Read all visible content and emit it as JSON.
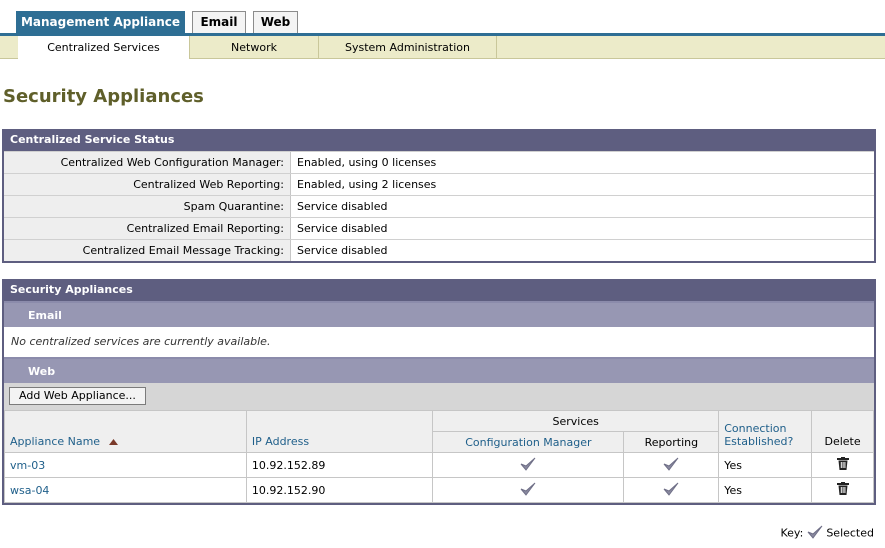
{
  "tabs": [
    {
      "label": "Management Appliance",
      "active": true
    },
    {
      "label": "Email",
      "active": false
    },
    {
      "label": "Web",
      "active": false
    }
  ],
  "subnav": [
    {
      "label": "Centralized Services",
      "active": true
    },
    {
      "label": "Network",
      "active": false
    },
    {
      "label": "System Administration",
      "active": false
    }
  ],
  "page_title": "Security Appliances",
  "status_panel": {
    "title": "Centralized Service Status",
    "rows": [
      {
        "label": "Centralized Web Configuration Manager:",
        "value": "Enabled, using 0 licenses"
      },
      {
        "label": "Centralized Web Reporting:",
        "value": "Enabled, using 2 licenses"
      },
      {
        "label": "Spam Quarantine:",
        "value": "Service disabled"
      },
      {
        "label": "Centralized Email Reporting:",
        "value": "Service disabled"
      },
      {
        "label": "Centralized Email Message Tracking:",
        "value": "Service disabled"
      }
    ]
  },
  "appliances_panel": {
    "title": "Security Appliances",
    "email": {
      "heading": "Email",
      "empty_message": "No centralized services are currently available."
    },
    "web": {
      "heading": "Web",
      "add_button": "Add Web Appliance...",
      "columns": {
        "name": "Appliance Name",
        "ip": "IP Address",
        "services": "Services",
        "config_manager": "Configuration Manager",
        "reporting": "Reporting",
        "connection": "Connection Established?",
        "delete": "Delete"
      },
      "rows": [
        {
          "name": "vm-03",
          "ip": "10.92.152.89",
          "config_manager": true,
          "reporting": true,
          "connection": "Yes"
        },
        {
          "name": "wsa-04",
          "ip": "10.92.152.90",
          "config_manager": true,
          "reporting": true,
          "connection": "Yes"
        }
      ]
    }
  },
  "key": {
    "label": "Key:",
    "selected": "Selected"
  },
  "colors": {
    "accent": "#2e6e94",
    "panel_header": "#5e5e80",
    "subheader": "#9797b3",
    "title": "#5f5f2a"
  },
  "icons": {
    "check": "check-icon",
    "delete": "trash-icon",
    "sort": "sort-ascending-icon"
  }
}
